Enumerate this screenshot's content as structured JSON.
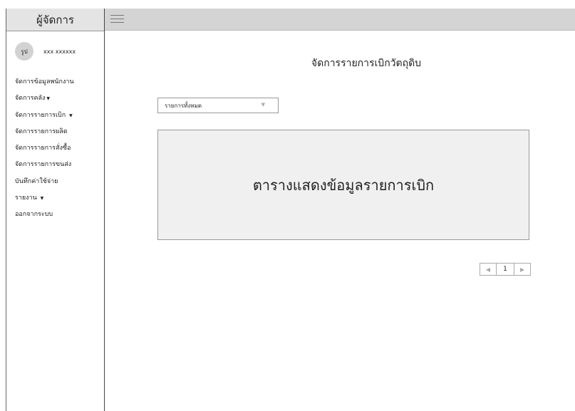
{
  "sidebar": {
    "title": "ผู้จัดการ",
    "avatar_text": "รูป",
    "username": "xxx xxxxxx",
    "items": [
      {
        "label": "จัดการข้อมูลพนักงาน",
        "caret": ""
      },
      {
        "label": "จัดการคลัง",
        "caret": "▼"
      },
      {
        "label": "จัดการรายการเบิก",
        "caret": "▼"
      },
      {
        "label": "จัดการรายการผลิต",
        "caret": ""
      },
      {
        "label": "จัดการรายการสั่งซื้อ",
        "caret": ""
      },
      {
        "label": "จัดการรายการขนส่ง",
        "caret": ""
      },
      {
        "label": "บันทึกค่าใช้จ่าย",
        "caret": ""
      },
      {
        "label": "รายงาน",
        "caret": "▼"
      },
      {
        "label": "ออกจากระบบ",
        "caret": ""
      }
    ]
  },
  "main": {
    "title": "จัดการรายการเบิกวัตถุดิบ",
    "filter": {
      "selected": "รายการทั้งหมด",
      "arrow_icon": "triangle-down-icon"
    },
    "table_placeholder": "ตารางแสดงข้อมูลรายการเบิก",
    "pagination": {
      "prev": "◀",
      "current": "1",
      "next": "▶"
    }
  },
  "colors": {
    "sidebar_header_bg": "#e4e4e4",
    "topbar_bg": "#d4d4d4",
    "table_bg": "#f0f0f0"
  }
}
